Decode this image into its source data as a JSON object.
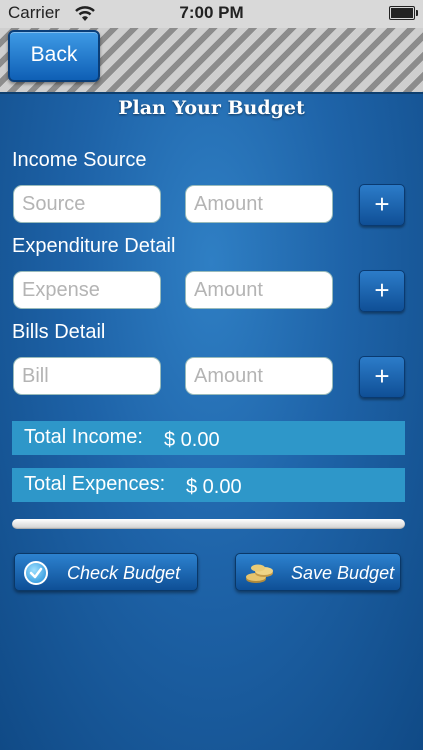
{
  "status_bar": {
    "carrier": "Carrier",
    "time": "7:00 PM"
  },
  "nav": {
    "back_label": "Back"
  },
  "page": {
    "title": "Plan Your Budget"
  },
  "income": {
    "label": "Income Source",
    "source_placeholder": "Source",
    "amount_placeholder": "Amount",
    "add_label": "+"
  },
  "expenditure": {
    "label": "Expenditure Detail",
    "expense_placeholder": "Expense",
    "amount_placeholder": "Amount",
    "add_label": "+"
  },
  "bills": {
    "label": "Bills Detail",
    "bill_placeholder": "Bill",
    "amount_placeholder": "Amount",
    "add_label": "+"
  },
  "totals": {
    "income_label": "Total Income:",
    "income_value": "$ 0.00",
    "expenses_label": "Total Expences:",
    "expenses_value": "$ 0.00"
  },
  "progress": {
    "value": 0
  },
  "actions": {
    "check_label": "Check Budget",
    "save_label": "Save Budget"
  }
}
